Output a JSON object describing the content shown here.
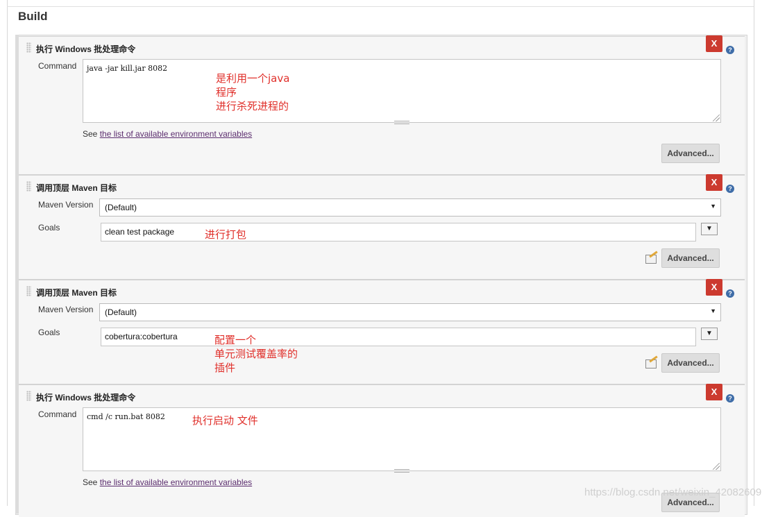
{
  "section": {
    "title": "Build"
  },
  "steps": [
    {
      "title": "执行 Windows 批处理命令",
      "delete_label": "X",
      "help_label": "?",
      "command_label": "Command",
      "command_value": "java -jar kill.jar 8082",
      "note": "是利用一个java\n程序\n进行杀死进程的",
      "see_prefix": "See",
      "see_link": "the list of available environment variables",
      "advanced_label": "Advanced..."
    },
    {
      "title": "调用顶层 Maven 目标",
      "delete_label": "X",
      "help_label": "?",
      "maven_version_label": "Maven Version",
      "maven_version_value": "(Default)",
      "goals_label": "Goals",
      "goals_value": "clean test package",
      "expand_label": "▼",
      "note": "进行打包",
      "advanced_label": "Advanced..."
    },
    {
      "title": "调用顶层 Maven 目标",
      "delete_label": "X",
      "help_label": "?",
      "maven_version_label": "Maven Version",
      "maven_version_value": "(Default)",
      "goals_label": "Goals",
      "goals_value": "cobertura:cobertura",
      "expand_label": "▼",
      "note": "配置一个\n单元测试覆盖率的\n插件",
      "advanced_label": "Advanced..."
    },
    {
      "title": "执行 Windows 批处理命令",
      "delete_label": "X",
      "help_label": "?",
      "command_label": "Command",
      "command_value": "cmd /c run.bat 8082",
      "note": "执行启动 文件",
      "see_prefix": "See",
      "see_link": "the list of available environment variables",
      "advanced_label": "Advanced..."
    }
  ],
  "watermark": "https://blog.csdn.net/weixin_42082609",
  "colors": {
    "delete": "#cc3a2f",
    "annotation": "#e0302b",
    "link": "#5b2d6e",
    "help": "#3f6da8"
  },
  "icons": [
    "grip-icon",
    "help-icon",
    "notepad-icon",
    "dropdown-arrow-icon",
    "resize-handle-icon"
  ]
}
